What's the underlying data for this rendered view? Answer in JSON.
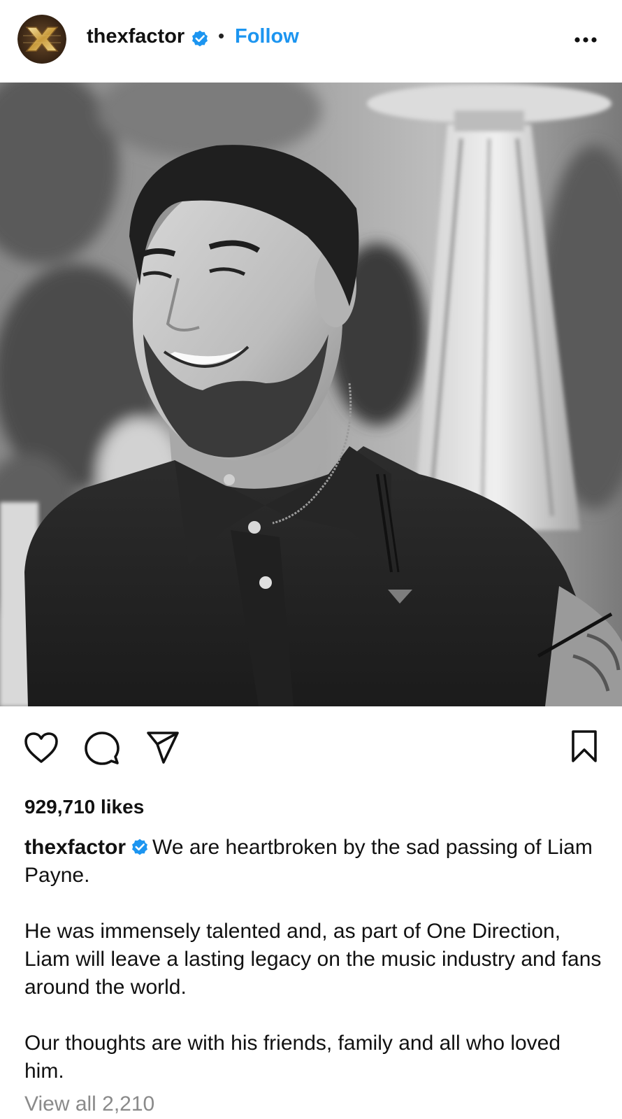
{
  "post": {
    "username": "thexfactor",
    "separator": "•",
    "follow_label": "Follow",
    "photo_alt": "Black and white photo of a smiling man in a dark polo shirt",
    "icons": {
      "avatar": "x-factor-logo",
      "verified": "verified-badge-icon",
      "more": "more-options-icon",
      "like": "heart-icon",
      "comment": "comment-icon",
      "share": "send-icon",
      "save": "bookmark-icon"
    },
    "accent_color": "#1c95f0",
    "likes_text": "929,710 likes",
    "caption": {
      "username": "thexfactor",
      "paragraphs": [
        "We are heartbroken by the sad passing of Liam Payne.",
        "He was immensely talented and, as part of One Direction, Liam will leave a lasting legacy on the music industry and fans around the world.",
        "Our thoughts are with his friends, family and all who loved him."
      ]
    },
    "view_all_comments": "View all 2,210"
  }
}
